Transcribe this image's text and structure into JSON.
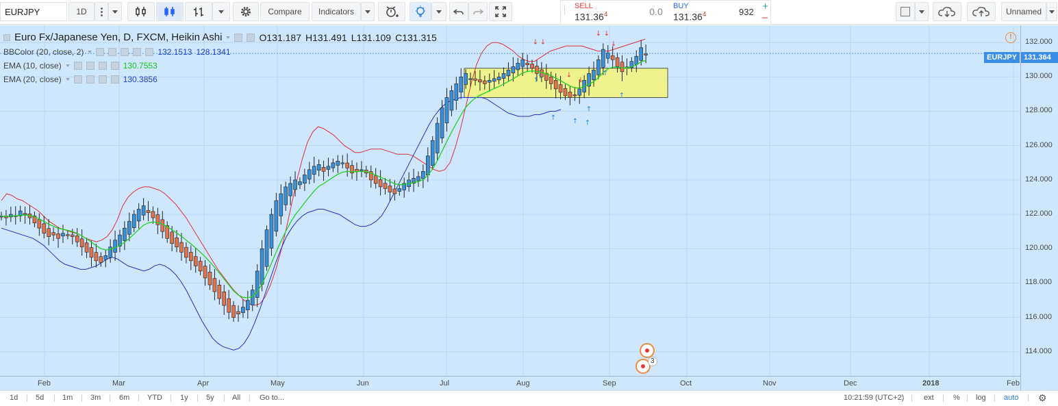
{
  "toolbar": {
    "symbol": "EURJPY",
    "interval": "1D",
    "compare_label": "Compare",
    "indicators_label": "Indicators",
    "layout_name": "Unnamed"
  },
  "trade": {
    "sell_label": "SELL",
    "sell_price": "131.36",
    "sell_pip": "4",
    "spread": "0.0",
    "buy_label": "BUY",
    "buy_price": "131.36",
    "buy_pip": "4",
    "quantity": "932",
    "plus": "+",
    "minus": "–"
  },
  "legend": {
    "title": "Euro Fx/Japanese Yen, D, FXCM, Heikin Ashi",
    "open": "O131.187",
    "high": "H131.491",
    "low": "L131.109",
    "close": "C131.315",
    "indicators": [
      {
        "name": "BBColor (20, close, 2)",
        "values": [
          "132.1513",
          "128.1341"
        ],
        "colors": [
          "#1e3fd0",
          "#1e3fd0"
        ]
      },
      {
        "name": "EMA (10, close)",
        "values": [
          "130.7553"
        ],
        "colors": [
          "#22cc22"
        ]
      },
      {
        "name": "EMA (20, close)",
        "values": [
          "130.3856"
        ],
        "colors": [
          "#1e3fd0"
        ]
      }
    ]
  },
  "price_axis": {
    "ticks": [
      "132.000",
      "130.000",
      "128.000",
      "126.000",
      "124.000",
      "122.000",
      "120.000",
      "118.000",
      "116.000",
      "114.000"
    ],
    "symbol_badge": "EURJPY",
    "last_price": "131.364"
  },
  "time_axis": {
    "ticks": [
      "Feb",
      "Mar",
      "Apr",
      "May",
      "Jun",
      "Jul",
      "Aug",
      "Sep",
      "Oct",
      "Nov",
      "Dec",
      "2018",
      "Feb"
    ]
  },
  "bottom": {
    "ranges": [
      "1d",
      "5d",
      "1m",
      "3m",
      "6m",
      "YTD",
      "1y",
      "5y",
      "All"
    ],
    "goto": "Go to...",
    "time": "10:21:59 (UTC+2)",
    "ext": "ext",
    "percent": "%",
    "log": "log",
    "auto": "auto"
  },
  "events_badge": "3",
  "colors": {
    "background": "#cfe7fd",
    "bull": "#3a8fd6",
    "bear": "#e0744f",
    "bb_upper": "#e0303a",
    "bb_lower": "#1f2fc8",
    "ema_fast": "#22d022",
    "highlight": "#f4f57a"
  },
  "chart_data": {
    "type": "candlestick",
    "price_range": [
      112.6,
      133.0
    ],
    "ylabel": "",
    "series": [
      {
        "name": "Heikin Ashi",
        "values": "ohlc_from_close"
      },
      {
        "name": "BB upper"
      },
      {
        "name": "BB lower"
      },
      {
        "name": "EMA 10"
      }
    ],
    "close": [
      121.9,
      121.8,
      122.0,
      121.9,
      122.2,
      122.0,
      121.8,
      121.5,
      121.2,
      120.9,
      120.7,
      120.8,
      120.6,
      120.9,
      120.8,
      120.7,
      120.4,
      120.1,
      119.8,
      119.5,
      119.3,
      119.2,
      119.6,
      120.1,
      120.5,
      120.8,
      121.2,
      121.6,
      122.0,
      122.3,
      122.5,
      122.1,
      121.8,
      121.4,
      121.0,
      120.6,
      120.3,
      120.1,
      119.8,
      119.5,
      119.3,
      119.0,
      118.7,
      118.3,
      117.9,
      117.5,
      117.1,
      116.7,
      116.3,
      116.0,
      116.2,
      116.6,
      117.0,
      117.6,
      118.7,
      120.0,
      121.1,
      122.0,
      122.8,
      123.2,
      123.6,
      123.8,
      124.0,
      123.9,
      124.3,
      124.6,
      124.8,
      124.9,
      124.5,
      124.8,
      125.0,
      125.1,
      125.0,
      124.7,
      124.4,
      124.5,
      124.6,
      124.4,
      124.0,
      123.8,
      123.6,
      123.5,
      123.3,
      123.2,
      123.5,
      123.8,
      124.0,
      124.1,
      124.2,
      124.5,
      125.4,
      126.3,
      127.3,
      128.2,
      128.8,
      129.2,
      129.6,
      130.0,
      130.2,
      129.9,
      129.8,
      129.7,
      129.6,
      129.8,
      129.9,
      130.0,
      130.2,
      130.4,
      130.6,
      130.8,
      131.0,
      130.7,
      130.5,
      130.2,
      130.0,
      129.8,
      129.6,
      129.3,
      129.1,
      128.9,
      128.8,
      128.9,
      129.3,
      129.8,
      130.2,
      130.4,
      131.0,
      131.6,
      131.4,
      131.0,
      130.6,
      130.3,
      130.5,
      130.9,
      131.2,
      131.7,
      131.3
    ],
    "bb_upper": [
      122.8,
      123.2,
      123.1,
      122.9,
      122.8,
      122.6,
      122.4,
      122.2,
      121.9,
      121.6,
      121.4,
      121.2,
      121.1,
      121.0,
      120.9,
      120.8,
      120.6,
      120.5,
      120.4,
      120.5,
      120.7,
      121.1,
      121.7,
      122.5,
      123.0,
      123.3,
      123.5,
      123.6,
      123.6,
      123.5,
      123.4,
      123.2,
      122.9,
      122.6,
      122.2,
      121.8,
      121.3,
      120.8,
      120.3,
      119.8,
      119.3,
      118.8,
      118.4,
      118.0,
      117.6,
      117.3,
      117.0,
      116.8,
      116.7,
      116.8,
      117.2,
      117.9,
      118.8,
      119.9,
      121.2,
      122.6,
      124.0,
      125.2,
      126.2,
      126.8,
      127.1,
      127.0,
      126.8,
      126.6,
      126.3,
      126.0,
      125.8,
      125.6,
      125.6,
      125.7,
      125.8,
      125.8,
      125.8,
      125.7,
      125.6,
      125.5,
      125.5,
      125.5,
      125.4,
      125.2,
      125.0,
      124.8,
      124.6,
      124.5,
      124.6,
      125.0,
      125.9,
      127.0,
      128.3,
      129.6,
      130.7,
      131.4,
      131.8,
      132.0,
      132.0,
      131.9,
      131.7,
      131.5,
      131.2,
      131.0,
      130.9,
      130.9,
      131.1,
      131.3,
      131.5,
      131.6,
      131.7,
      131.8,
      131.8,
      131.8,
      131.8,
      131.7,
      131.6,
      131.5,
      131.5,
      131.5,
      131.6,
      131.7,
      131.8,
      131.9,
      132.0,
      132.1,
      132.2
    ],
    "bb_lower": [
      121.2,
      121.1,
      121.0,
      120.9,
      120.8,
      120.7,
      120.6,
      120.4,
      120.2,
      119.9,
      119.6,
      119.3,
      119.1,
      119.0,
      118.9,
      118.8,
      118.8,
      118.9,
      119.0,
      119.2,
      119.4,
      119.5,
      119.4,
      119.2,
      119.0,
      118.9,
      118.8,
      118.7,
      118.8,
      119.0,
      119.1,
      119.0,
      118.8,
      118.5,
      118.1,
      117.6,
      117.0,
      116.4,
      115.8,
      115.3,
      114.8,
      114.5,
      114.3,
      114.2,
      114.1,
      114.2,
      114.5,
      115.0,
      115.7,
      116.5,
      117.4,
      118.3,
      119.2,
      120.0,
      120.7,
      121.2,
      121.6,
      121.9,
      122.1,
      122.2,
      122.3,
      122.3,
      122.2,
      122.1,
      122.0,
      121.8,
      121.6,
      121.4,
      121.3,
      121.3,
      121.4,
      121.6,
      121.9,
      122.4,
      123.0,
      123.6,
      124.2,
      124.8,
      125.4,
      126.0,
      126.6,
      127.2,
      127.7,
      128.1,
      128.4,
      128.6,
      128.7,
      128.8,
      128.8,
      128.8,
      128.8,
      128.8,
      128.7,
      128.5,
      128.3,
      128.1,
      127.9,
      127.8,
      127.7,
      127.7,
      127.7,
      127.8,
      127.8,
      127.9,
      128.0,
      128.0,
      128.1
    ]
  }
}
